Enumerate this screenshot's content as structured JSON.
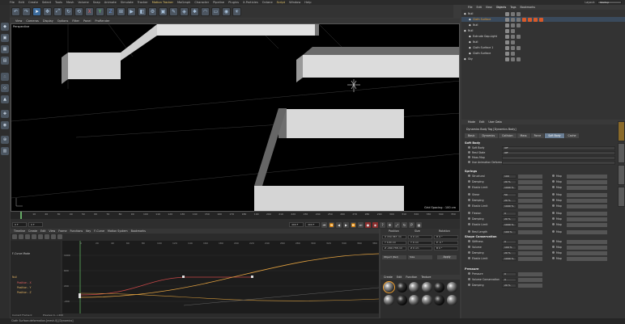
{
  "menu": [
    "File",
    "Edit",
    "Create",
    "Select",
    "Tools",
    "Mesh",
    "Volume",
    "Snap",
    "Animate",
    "Simulate",
    "Tracker",
    "Motion Tracker",
    "MoGraph",
    "Character",
    "Pipeline",
    "Plugins",
    "X-Particles",
    "Octane",
    "Script",
    "Window",
    "Help"
  ],
  "layout": {
    "label": "Layout:",
    "value": "Startup"
  },
  "viewport": {
    "menu": [
      "View",
      "Cameras",
      "Display",
      "Options",
      "Filter",
      "Panel",
      "ProRender"
    ],
    "name": "Perspective",
    "grid_spacing": "Grid Spacing : 100 cm"
  },
  "timeline": {
    "ticks": [
      "0",
      "10",
      "20",
      "30",
      "40",
      "50",
      "60",
      "70",
      "80",
      "90",
      "100",
      "110",
      "120",
      "130",
      "140",
      "150",
      "160",
      "170",
      "180",
      "190",
      "200",
      "210",
      "220",
      "230",
      "240",
      "250",
      "260",
      "270",
      "280",
      "290",
      "300",
      "310",
      "320",
      "330",
      "340",
      "350"
    ],
    "start": "0 F",
    "current": "0 F",
    "end": "400 F",
    "end2": "400 F",
    "frame": "0 F"
  },
  "timeline_panel": {
    "title": "Timeline",
    "menu": [
      "Create",
      "Edit",
      "View",
      "Frame",
      "Functions",
      "Key",
      "F-Curve",
      "Motion System",
      "Bookmarks"
    ],
    "mode": "F-Curve Mode",
    "tracks": [
      {
        "name": "Null"
      },
      {
        "name": "Position . X"
      },
      {
        "name": "Position . Y"
      },
      {
        "name": "Position . Z"
      }
    ],
    "y_labels": [
      "1000",
      "600",
      "200",
      "-200",
      "-600"
    ],
    "x_labels": [
      "0",
      "20",
      "40",
      "60",
      "80",
      "100",
      "120",
      "140",
      "160",
      "180",
      "200",
      "220",
      "240",
      "260",
      "280",
      "300",
      "320",
      "340",
      "360",
      "380"
    ],
    "current_frame": "Current Frame  0",
    "preview": "Preview  0-->400"
  },
  "coords": {
    "headers": [
      "Position",
      "Size",
      "Rotation"
    ],
    "rows": [
      [
        "X  150.367 cm",
        "X  0 cm",
        "H  0 °"
      ],
      [
        "Y  120 cm",
        "Y  0 cm",
        "P  -4 °"
      ],
      [
        "Z  -290.738 cm",
        "Z  0 cm",
        "B  0 °"
      ]
    ],
    "object": "Object (Rel)",
    "size": "Size",
    "apply": "Apply"
  },
  "materials": {
    "menu": [
      "Create",
      "Edit",
      "Function",
      "Texture"
    ],
    "count": 12
  },
  "objects": {
    "tabs": [
      "File",
      "Edit",
      "View",
      "Objects",
      "Tags",
      "Bookmarks"
    ],
    "rows": [
      {
        "name": "Null",
        "indent": 0,
        "sel": false
      },
      {
        "name": "Cloth Surface",
        "indent": 6,
        "sel": true
      },
      {
        "name": "Null",
        "indent": 6,
        "sel": false
      },
      {
        "name": "Null",
        "indent": 0,
        "sel": false
      },
      {
        "name": "Extrude Gap.Light",
        "indent": 6,
        "sel": false
      },
      {
        "name": "Null",
        "indent": 6,
        "sel": false
      },
      {
        "name": "Cloth Surface 1",
        "indent": 6,
        "sel": false
      },
      {
        "name": "Cloth Surface",
        "indent": 6,
        "sel": false
      },
      {
        "name": "Sky",
        "indent": 0,
        "sel": false
      }
    ]
  },
  "attributes": {
    "menu": [
      "Mode",
      "Edit",
      "User Data"
    ],
    "title": "Dynamics Body Tag [Dynamics Body]",
    "tabs": [
      "Basic",
      "Dynamics",
      "Collision",
      "Mass",
      "Force",
      "Soft Body",
      "Cache"
    ],
    "active_tab": "Soft Body",
    "sections": {
      "soft_body": "Soft Body",
      "springs": "Springs",
      "shape": "Shape Conservation",
      "pressure": "Pressure"
    },
    "soft_body_rows": [
      {
        "label": "Soft Body",
        "value": "Off"
      },
      {
        "label": "Rest State",
        "value": "Off"
      },
      {
        "label": "Mass Map",
        "value": ""
      },
      {
        "label": "Use Animation Deformers",
        "value": ""
      }
    ],
    "springs_left": [
      {
        "label": "Structural",
        "value": "100"
      },
      {
        "label": "Damping",
        "value": "20 %"
      },
      {
        "label": "Elastic Limit",
        "value": "1000 %"
      },
      {
        "label": "Shear",
        "value": "50"
      },
      {
        "label": "Damping",
        "value": "20 %"
      },
      {
        "label": "Elastic Limit",
        "value": "1000 %"
      },
      {
        "label": "Flexion",
        "value": "0"
      },
      {
        "label": "Damping",
        "value": "20 %"
      },
      {
        "label": "Elastic Limit",
        "value": "1000 %"
      },
      {
        "label": "Rest Length",
        "value": "100 %"
      }
    ],
    "springs_right": [
      "Map",
      "Map",
      "Map",
      "Map",
      "Map",
      "Map",
      "Map",
      "Map",
      "Map",
      "Map"
    ],
    "shape_rows": [
      {
        "label": "Stiffness",
        "value": "0"
      },
      {
        "label": "Volume",
        "value": "100 %"
      },
      {
        "label": "Damping",
        "value": "20 %"
      },
      {
        "label": "Elastic Limit",
        "value": "1000 %"
      }
    ],
    "shape_right": [
      "Map",
      "Map",
      "Map",
      "Map"
    ],
    "pressure_rows": [
      {
        "label": "Pressure",
        "value": "0"
      },
      {
        "label": "Volume Conservation",
        "value": "0"
      },
      {
        "label": "Damping",
        "value": "20 %"
      }
    ]
  },
  "status": "Cloth Surface.deformation.[mesh.0].[Dynamics]"
}
